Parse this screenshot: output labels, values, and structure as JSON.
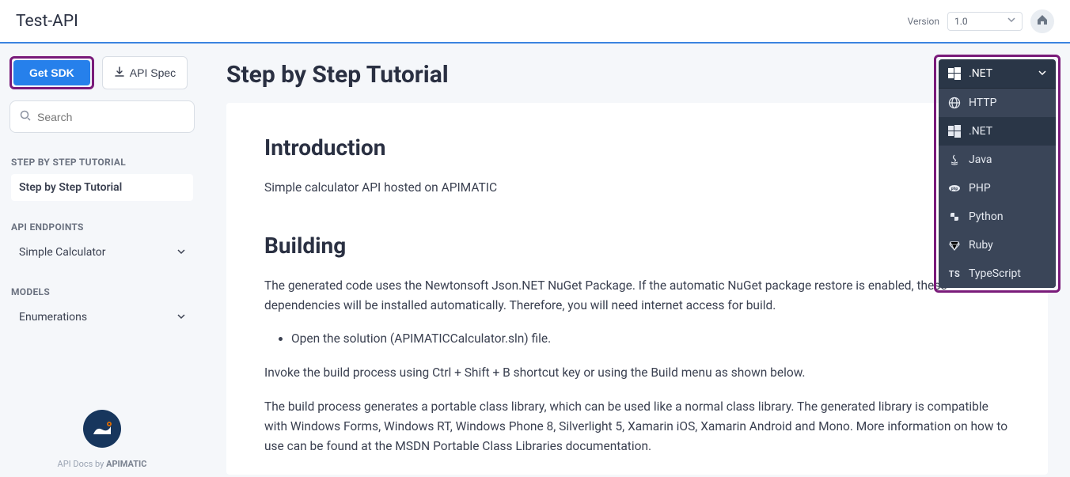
{
  "topbar": {
    "title": "Test-API",
    "version_label": "Version",
    "version_value": "1.0"
  },
  "sidebar": {
    "get_sdk_label": "Get SDK",
    "api_spec_label": "API Spec",
    "search_placeholder": "Search",
    "sections": [
      {
        "heading": "STEP BY STEP TUTORIAL",
        "items": [
          {
            "label": "Step by Step Tutorial",
            "active": true,
            "expandable": false
          }
        ]
      },
      {
        "heading": "API ENDPOINTS",
        "items": [
          {
            "label": "Simple Calculator",
            "active": false,
            "expandable": true
          }
        ]
      },
      {
        "heading": "MODELS",
        "items": [
          {
            "label": "Enumerations",
            "active": false,
            "expandable": true
          }
        ]
      }
    ],
    "footer_prefix": "API Docs by ",
    "footer_brand": "APIMATIC"
  },
  "main": {
    "page_title": "Step by Step Tutorial",
    "intro_heading": "Introduction",
    "intro_text": "Simple calculator API hosted on APIMATIC",
    "building_heading": "Building",
    "building_p1": "The generated code uses the Newtonsoft Json.NET NuGet Package. If the automatic NuGet package restore is enabled, these dependencies will be installed automatically. Therefore, you will need internet access for build.",
    "building_li1": "Open the solution (APIMATICCalculator.sln) file.",
    "building_p2": "Invoke the build process using Ctrl + Shift + B shortcut key or using the Build menu as shown below.",
    "building_p3": "The build process generates a portable class library, which can be used like a normal class library. The generated library is compatible with Windows Forms, Windows RT, Windows Phone 8, Silverlight 5, Xamarin iOS, Xamarin Android and Mono. More information on how to use can be found at the MSDN Portable Class Libraries documentation."
  },
  "lang_panel": {
    "selected": ".NET",
    "options": [
      {
        "label": "HTTP",
        "icon": "globe"
      },
      {
        "label": ".NET",
        "icon": "windows",
        "selected": true
      },
      {
        "label": "Java",
        "icon": "java"
      },
      {
        "label": "PHP",
        "icon": "php"
      },
      {
        "label": "Python",
        "icon": "python"
      },
      {
        "label": "Ruby",
        "icon": "ruby"
      },
      {
        "label": "TypeScript",
        "icon": "ts"
      }
    ]
  }
}
